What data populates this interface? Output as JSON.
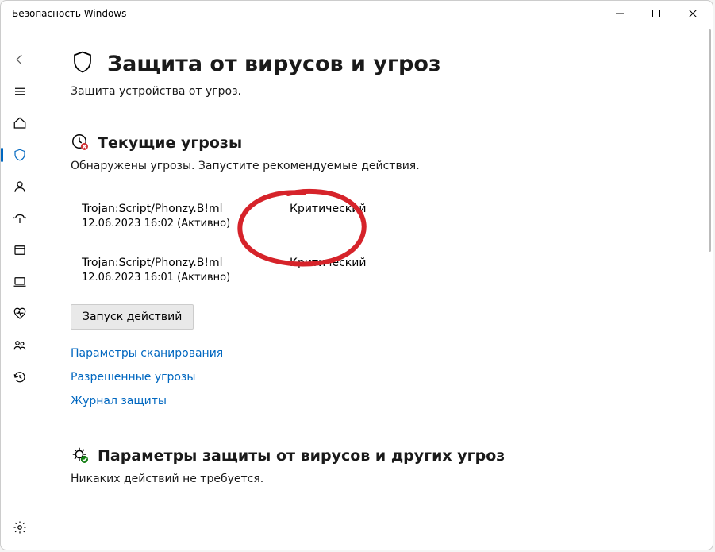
{
  "window": {
    "title": "Безопасность Windows"
  },
  "header": {
    "title": "Защита от вирусов и угроз",
    "subtitle": "Защита устройства от угроз."
  },
  "threats_section": {
    "title": "Текущие угрозы",
    "message": "Обнаружены угрозы. Запустите рекомендуемые действия.",
    "items": [
      {
        "name": "Trojan:Script/Phonzy.B!ml",
        "meta": "12.06.2023 16:02 (Активно)",
        "severity": "Критический"
      },
      {
        "name": "Trojan:Script/Phonzy.B!ml",
        "meta": "12.06.2023 16:01 (Активно)",
        "severity": "Критический"
      }
    ],
    "action": "Запуск действий",
    "links": {
      "scan_options": "Параметры сканирования",
      "allowed": "Разрешенные угрозы",
      "history": "Журнал защиты"
    }
  },
  "settings_section": {
    "title": "Параметры защиты от вирусов и других угроз",
    "message": "Никаких действий не требуется."
  }
}
